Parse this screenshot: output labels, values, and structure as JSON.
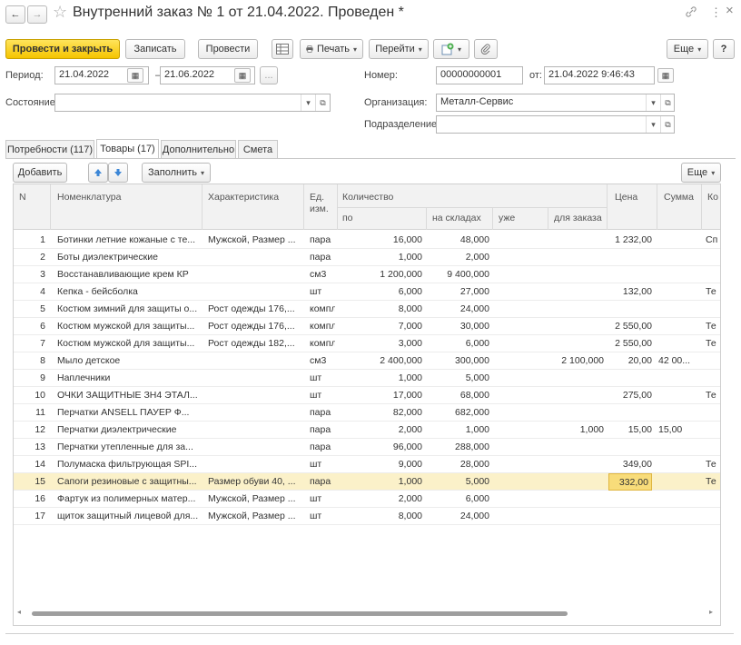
{
  "window": {
    "title": "Внутренний заказ № 1 от 21.04.2022. Проведен *",
    "back": "←",
    "forward": "→",
    "star": "☆",
    "link_icon": "link-icon",
    "more": "⋮",
    "close": "×"
  },
  "toolbar": {
    "post_close": "Провести и закрыть",
    "save": "Записать",
    "post": "Провести",
    "print": "Печать",
    "goto": "Перейти",
    "more": "Еще",
    "help": "?"
  },
  "form": {
    "period_label": "Период:",
    "period_from": "21.04.2022",
    "period_dash": "–",
    "period_to": "21.06.2022",
    "period_dots": "...",
    "state_label": "Состояние:",
    "state_value": "",
    "number_label": "Номер:",
    "number_value": "00000000001",
    "date_label": "от:",
    "date_value": "21.04.2022  9:46:43",
    "org_label": "Организация:",
    "org_value": "Металл-Сервис",
    "dept_label": "Подразделение:",
    "dept_value": ""
  },
  "tabs": [
    "Потребности (117)",
    "Товары (17)",
    "Дополнительно",
    "Смета"
  ],
  "table_toolbar": {
    "add": "Добавить",
    "fill": "Заполнить",
    "more": "Еще"
  },
  "columns": {
    "n": "N",
    "nom": "Номенклатура",
    "char": "Характеристика",
    "unit": "Ед.",
    "unit2": "изм.",
    "qty": "Количество",
    "qty_po": "по",
    "qty_stock": "на складах",
    "qty_already": "уже",
    "qty_order": "для заказа",
    "price": "Цена",
    "sum": "Сумма",
    "ko": "Ко"
  },
  "rows": [
    {
      "n": "1",
      "nom": "Ботинки летние кожаные с те...",
      "char": "Мужской, Размер ...",
      "unit": "пара",
      "po": "16,000",
      "stock": "48,000",
      "already": "",
      "order": "",
      "price": "1 232,00",
      "sum": "",
      "ko": "Сп"
    },
    {
      "n": "2",
      "nom": "Боты диэлектрические",
      "char": "",
      "unit": "пара",
      "po": "1,000",
      "stock": "2,000",
      "already": "",
      "order": "",
      "price": "",
      "sum": "",
      "ko": ""
    },
    {
      "n": "3",
      "nom": "Восстанавливающие крем КР",
      "char": "",
      "unit": "см3",
      "po": "1 200,000",
      "stock": "9 400,000",
      "already": "",
      "order": "",
      "price": "",
      "sum": "",
      "ko": ""
    },
    {
      "n": "4",
      "nom": "Кепка - бейсболка",
      "char": "",
      "unit": "шт",
      "po": "6,000",
      "stock": "27,000",
      "already": "",
      "order": "",
      "price": "132,00",
      "sum": "",
      "ko": "Те"
    },
    {
      "n": "5",
      "nom": "Костюм зимний для защиты о...",
      "char": "Рост одежды 176,...",
      "unit": "компл",
      "po": "8,000",
      "stock": "24,000",
      "already": "",
      "order": "",
      "price": "",
      "sum": "",
      "ko": ""
    },
    {
      "n": "6",
      "nom": "Костюм мужской для защиты...",
      "char": "Рост одежды 176,...",
      "unit": "компл",
      "po": "7,000",
      "stock": "30,000",
      "already": "",
      "order": "",
      "price": "2 550,00",
      "sum": "",
      "ko": "Те"
    },
    {
      "n": "7",
      "nom": "Костюм мужской для защиты...",
      "char": "Рост одежды 182,...",
      "unit": "компл",
      "po": "3,000",
      "stock": "6,000",
      "already": "",
      "order": "",
      "price": "2 550,00",
      "sum": "",
      "ko": "Те"
    },
    {
      "n": "8",
      "nom": "Мыло детское",
      "char": "",
      "unit": "см3",
      "po": "2 400,000",
      "stock": "300,000",
      "already": "",
      "order": "2 100,000",
      "price": "20,00",
      "sum": "42 00...",
      "ko": ""
    },
    {
      "n": "9",
      "nom": "Наплечники",
      "char": "",
      "unit": "шт",
      "po": "1,000",
      "stock": "5,000",
      "already": "",
      "order": "",
      "price": "",
      "sum": "",
      "ko": ""
    },
    {
      "n": "10",
      "nom": "ОЧКИ ЗАЩИТНЫЕ ЗН4 ЭТАЛ...",
      "char": "",
      "unit": "шт",
      "po": "17,000",
      "stock": "68,000",
      "already": "",
      "order": "",
      "price": "275,00",
      "sum": "",
      "ko": "Те"
    },
    {
      "n": "11",
      "nom": "Перчатки ANSELL  ПАУЕР Ф...",
      "char": "",
      "unit": "пара",
      "po": "82,000",
      "stock": "682,000",
      "already": "",
      "order": "",
      "price": "",
      "sum": "",
      "ko": ""
    },
    {
      "n": "12",
      "nom": "Перчатки диэлектрические",
      "char": "",
      "unit": "пара",
      "po": "2,000",
      "stock": "1,000",
      "already": "",
      "order": "1,000",
      "price": "15,00",
      "sum": "15,00",
      "ko": ""
    },
    {
      "n": "13",
      "nom": "Перчатки утепленные для за...",
      "char": "",
      "unit": "пара",
      "po": "96,000",
      "stock": "288,000",
      "already": "",
      "order": "",
      "price": "",
      "sum": "",
      "ko": ""
    },
    {
      "n": "14",
      "nom": "Полумаска фильтрующая SPI...",
      "char": "",
      "unit": "шт",
      "po": "9,000",
      "stock": "28,000",
      "already": "",
      "order": "",
      "price": "349,00",
      "sum": "",
      "ko": "Те"
    },
    {
      "n": "15",
      "nom": "Сапоги резиновые с защитны...",
      "char": "Размер обуви 40, ...",
      "unit": "пара",
      "po": "1,000",
      "stock": "5,000",
      "already": "",
      "order": "",
      "price": "332,00",
      "sum": "",
      "ko": "Те"
    },
    {
      "n": "16",
      "nom": "Фартук из полимерных матер...",
      "char": "Мужской, Размер ...",
      "unit": "шт",
      "po": "2,000",
      "stock": "6,000",
      "already": "",
      "order": "",
      "price": "",
      "sum": "",
      "ko": ""
    },
    {
      "n": "17",
      "nom": "щиток защитный лицевой для...",
      "char": "Мужской, Размер ...",
      "unit": "шт",
      "po": "8,000",
      "stock": "24,000",
      "already": "",
      "order": "",
      "price": "",
      "sum": "",
      "ko": ""
    }
  ],
  "colors": {
    "primary": "#f5c400",
    "selected_row": "#fbf1c9",
    "header_bg": "#f2f2f2",
    "arrow_blue": "#3b86d6"
  }
}
